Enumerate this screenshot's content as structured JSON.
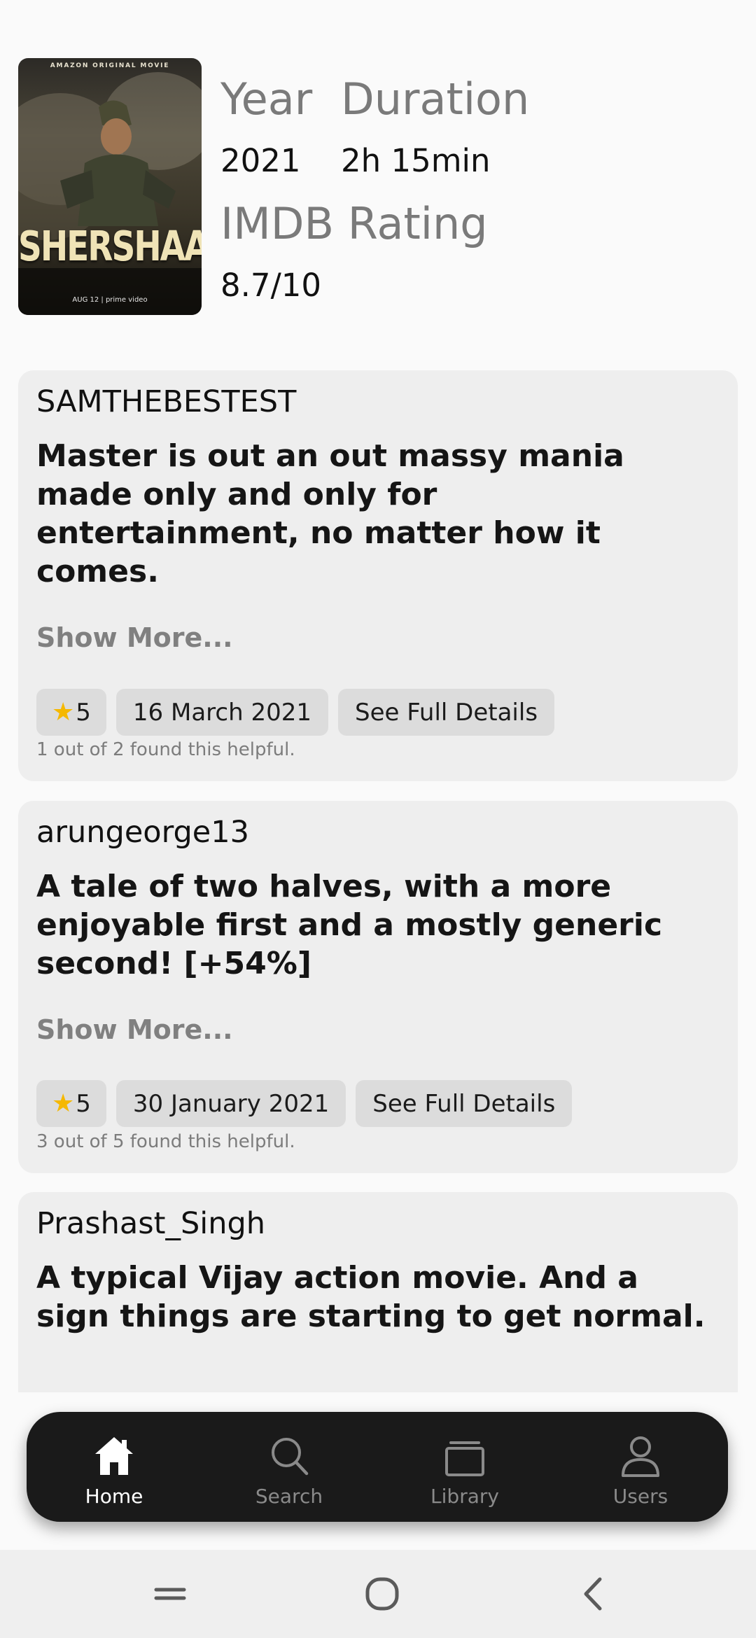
{
  "movie": {
    "poster": {
      "top_text": "AMAZON ORIGINAL MOVIE",
      "title": "SHERSHAAH",
      "footer": "AUG 12 | prime video"
    },
    "year_label": "Year",
    "year_value": "2021",
    "duration_label": "Duration",
    "duration_value": "2h 15min",
    "rating_label": "IMDB Rating",
    "rating_value": "8.7/10"
  },
  "reviews": [
    {
      "author": "SAMTHEBESTEST",
      "text": "Master is out an out massy mania made only and only for entertainment, no matter how it comes.",
      "show_more": "Show More...",
      "rating": "5",
      "date": "16 March 2021",
      "details": "See Full Details",
      "helpful": "1 out of 2 found this helpful."
    },
    {
      "author": "arungeorge13",
      "text": "A tale of two halves, with a more enjoyable first and a mostly generic second! [+54%]",
      "show_more": "Show More...",
      "rating": "5",
      "date": "30 January 2021",
      "details": "See Full Details",
      "helpful": "3 out of 5 found this helpful."
    },
    {
      "author": "Prashast_Singh",
      "text": "A typical Vijay action movie. And a sign things are starting to get normal."
    }
  ],
  "nav": {
    "items": [
      {
        "label": "Home",
        "icon": "home-icon",
        "active": true
      },
      {
        "label": "Search",
        "icon": "search-icon",
        "active": false
      },
      {
        "label": "Library",
        "icon": "library-icon",
        "active": false
      },
      {
        "label": "Users",
        "icon": "user-icon",
        "active": false
      }
    ]
  },
  "colors": {
    "card_bg": "#eeeeee",
    "nav_bg": "#1a1a1a",
    "star": "#f5b800"
  }
}
